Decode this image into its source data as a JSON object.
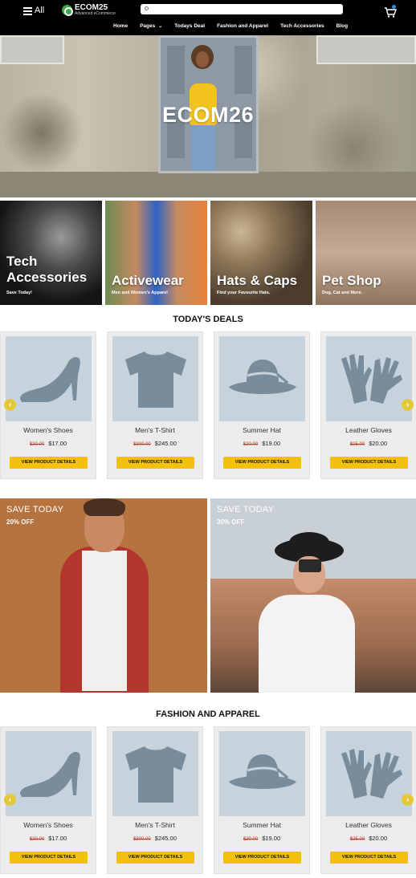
{
  "header": {
    "menu_label": "All",
    "logo_title": "ECOM25",
    "logo_subtitle": "Advanced eCommerce",
    "search_placeholder": "",
    "nav": [
      "Home",
      "Pages",
      "Todays Deal",
      "Fashion and Apparel",
      "Tech Accessories",
      "Blog"
    ]
  },
  "hero": {
    "title": "ECOM26"
  },
  "categories": [
    {
      "title_line1": "Tech",
      "title_line2": "Accessories",
      "subtitle": "Save Today!"
    },
    {
      "title_line1": "Activewear",
      "title_line2": "",
      "subtitle": "Men and Women's Apparel"
    },
    {
      "title_line1": "Hats & Caps",
      "title_line2": "",
      "subtitle": "Find your Favourite Hats."
    },
    {
      "title_line1": "Pet Shop",
      "title_line2": "",
      "subtitle": "Dog, Cat and More."
    }
  ],
  "deals": {
    "title": "TODAY'S DEALS",
    "products": [
      {
        "name": "Women's Shoes",
        "old_price": "$20.00",
        "price": "$17.00",
        "button": "VIEW PRODUCT DETAILS",
        "icon": "shoe-icon"
      },
      {
        "name": "Men's T-Shirt",
        "old_price": "$300.00",
        "price": "$245.00",
        "button": "VIEW PRODUCT DETAILS",
        "icon": "tshirt-icon"
      },
      {
        "name": "Summer Hat",
        "old_price": "$20.00",
        "price": "$19.00",
        "button": "VIEW PRODUCT DETAILS",
        "icon": "hat-icon"
      },
      {
        "name": "Leather Gloves",
        "old_price": "$25.00",
        "price": "$20.00",
        "button": "VIEW PRODUCT DETAILS",
        "icon": "gloves-icon"
      }
    ]
  },
  "promos": [
    {
      "title": "SAVE TODAY",
      "discount": "20% OFF"
    },
    {
      "title": "SAVE TODAY",
      "discount": "30% OFF"
    }
  ],
  "fashion": {
    "title": "FASHION AND APPAREL",
    "products": [
      {
        "name": "Women's Shoes",
        "old_price": "$20.00",
        "price": "$17.00",
        "button": "VIEW PRODUCT DETAILS",
        "icon": "shoe-icon"
      },
      {
        "name": "Men's T-Shirt",
        "old_price": "$300.00",
        "price": "$245.00",
        "button": "VIEW PRODUCT DETAILS",
        "icon": "tshirt-icon"
      },
      {
        "name": "Summer Hat",
        "old_price": "$20.00",
        "price": "$19.00",
        "button": "VIEW PRODUCT DETAILS",
        "icon": "hat-icon"
      },
      {
        "name": "Leather Gloves",
        "old_price": "$25.00",
        "price": "$20.00",
        "button": "VIEW PRODUCT DETAILS",
        "icon": "gloves-icon"
      }
    ]
  },
  "colors": {
    "header_bg": "#000000",
    "accent_yellow": "#f2c00d",
    "product_icon": "#788c9c",
    "product_bg": "#c6d3dc"
  }
}
